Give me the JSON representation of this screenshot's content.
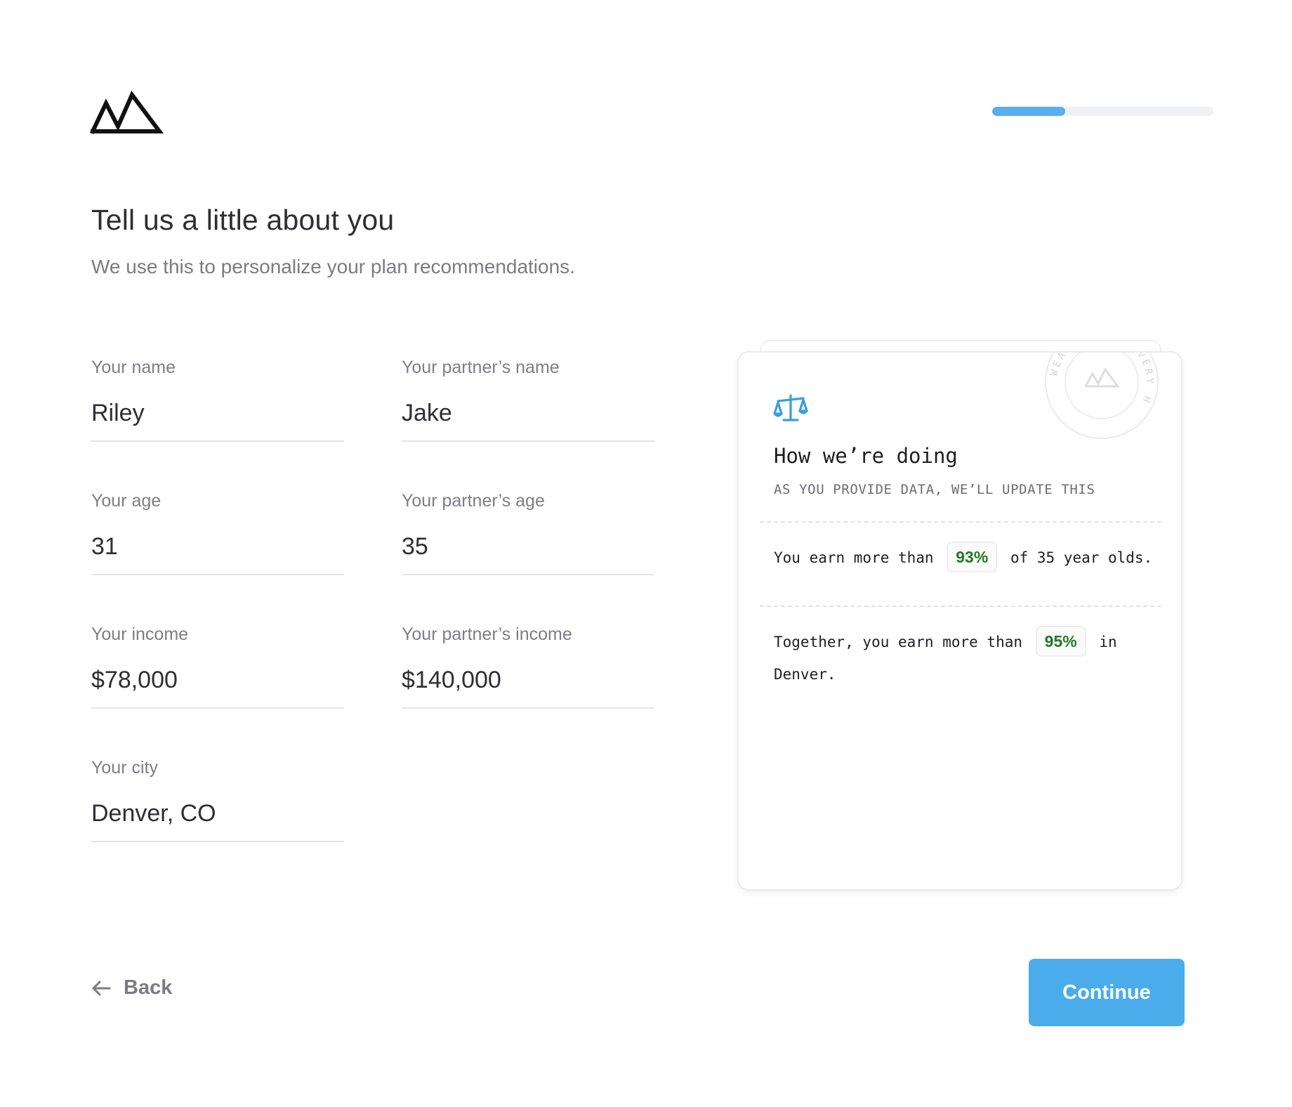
{
  "header": {
    "logo_icon": "mountains-logo-icon",
    "progress_fraction": 0.33
  },
  "page": {
    "title": "Tell us a little about you",
    "subtitle": "We use this to personalize your plan recommendations."
  },
  "form": {
    "your_name": {
      "label": "Your name",
      "value": "Riley"
    },
    "partner_name": {
      "label": "Your partner’s name",
      "value": "Jake"
    },
    "your_age": {
      "label": "Your age",
      "value": "31"
    },
    "partner_age": {
      "label": "Your partner’s age",
      "value": "35"
    },
    "your_income": {
      "label": "Your income",
      "value": "$78,000"
    },
    "partner_income": {
      "label": "Your partner’s income",
      "value": "$140,000"
    },
    "your_city": {
      "label": "Your city",
      "value": "Denver, CO"
    }
  },
  "card": {
    "icon": "scale-icon",
    "seal_text": "WEALTH FOR EVERY H",
    "title": "How we’re doing",
    "subtitle": "AS YOU PROVIDE DATA, WE’LL UPDATE THIS",
    "stat1": {
      "before": "You earn more than",
      "value": "93%",
      "after": "of 35 year olds."
    },
    "stat2": {
      "before": "Together, you earn more than",
      "value": "95%",
      "after": "in Denver."
    }
  },
  "nav": {
    "back_label": "Back",
    "back_icon": "arrow-left-icon",
    "continue_label": "Continue"
  },
  "colors": {
    "accent": "#4aaceb",
    "progress": "#5aaeef",
    "percent_text": "#237a23"
  }
}
